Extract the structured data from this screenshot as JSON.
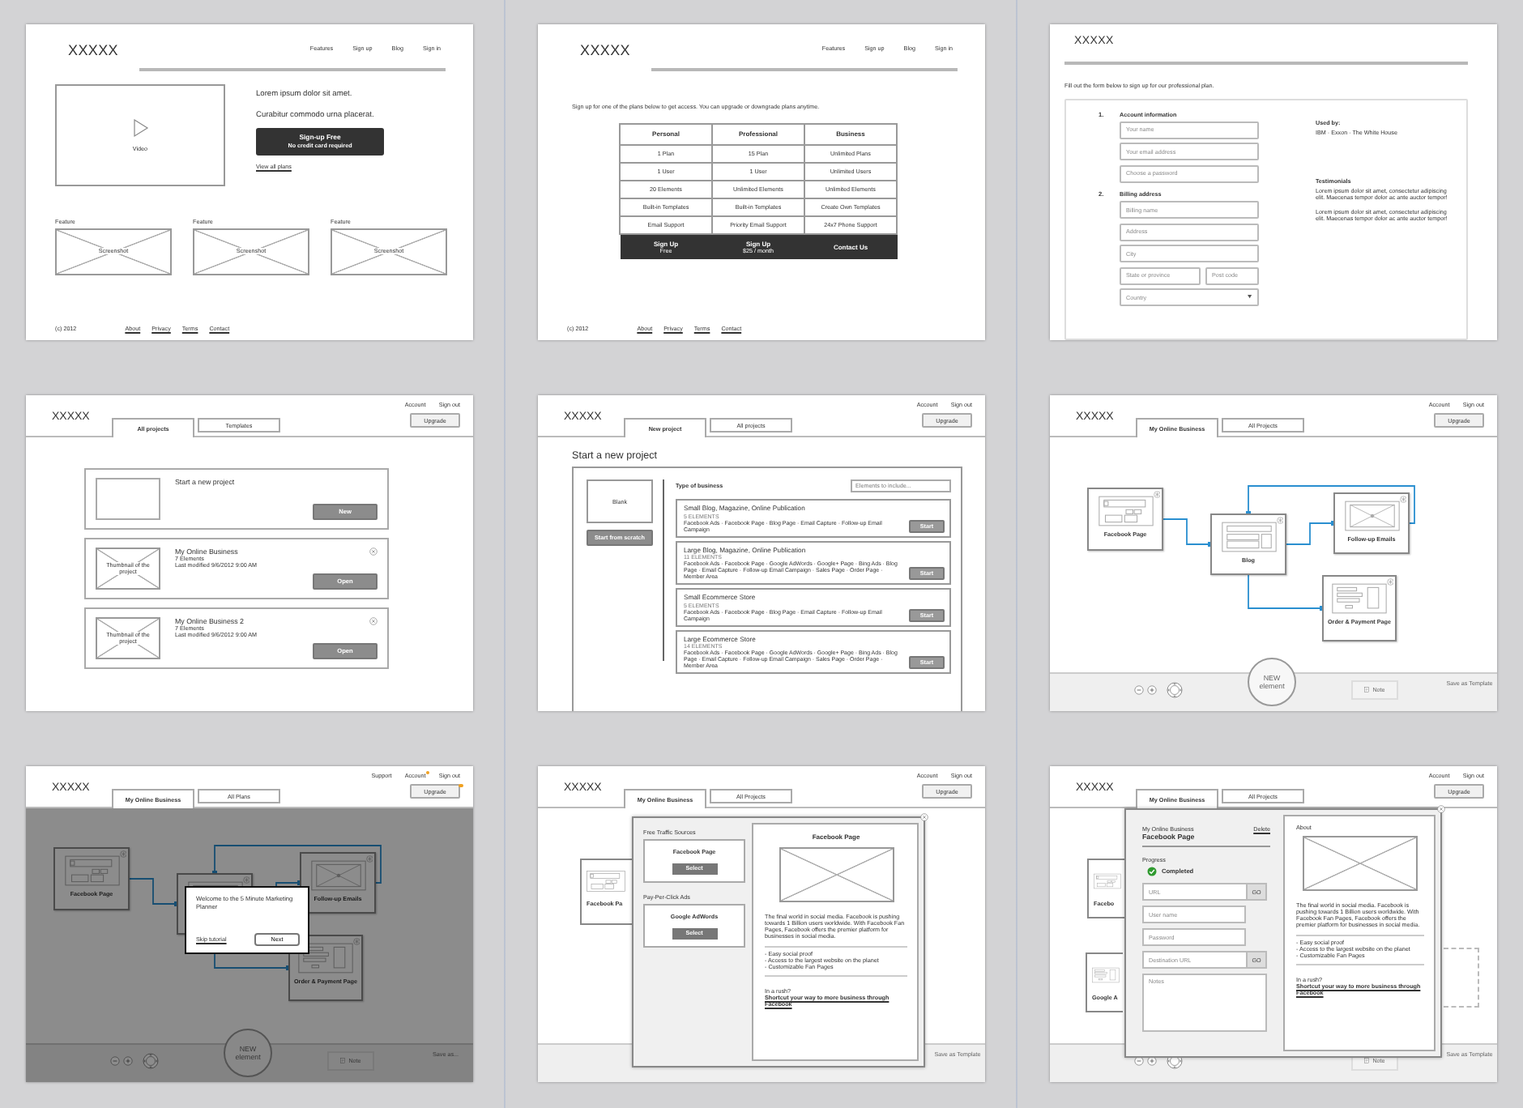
{
  "panels": [
    {
      "kind": "landing",
      "logo": "XXXXX",
      "nav": [
        "Features",
        "Sign up",
        "Blog",
        "Sign in"
      ],
      "video_label": "Video",
      "headline": "Lorem ipsum dolor sit amet.",
      "subhead": "Curabitur commodo urna placerat.",
      "cta": {
        "label": "Sign-up Free",
        "note": "No credit card required"
      },
      "plans_link": "View all plans",
      "features": [
        {
          "title": "Feature",
          "image_label": "Screenshot"
        },
        {
          "title": "Feature",
          "image_label": "Screenshot"
        },
        {
          "title": "Feature",
          "image_label": "Screenshot"
        }
      ],
      "copyright": "(c) 2012",
      "footer_links": [
        "About",
        "Privacy",
        "Terms",
        "Contact"
      ]
    },
    {
      "kind": "pricing",
      "logo": "XXXXX",
      "nav": [
        "Features",
        "Sign up",
        "Blog",
        "Sign in"
      ],
      "intro": "Sign up for one of the plans below to get access.  You can upgrade or downgrade plans anytime.",
      "table": {
        "columns": [
          "Personal",
          "Professional",
          "Business"
        ],
        "rows": [
          [
            "1 Plan",
            "15 Plan",
            "Unlimited Plans"
          ],
          [
            "1 User",
            "1 User",
            "Unlimited Users"
          ],
          [
            "20 Elements",
            "Unlimited Elements",
            "Unlimited Elements"
          ],
          [
            "Built-in Templates",
            "Built-in Templates",
            "Create Own Templates"
          ],
          [
            "Email Support",
            "Priority Email Support",
            "24x7 Phone Support"
          ]
        ],
        "actions": [
          {
            "label": "Sign Up",
            "note": "Free"
          },
          {
            "label": "Sign Up",
            "note": "$25 / month"
          },
          {
            "label": "Contact Us"
          }
        ]
      },
      "copyright": "(c) 2012",
      "footer_links": [
        "About",
        "Privacy",
        "Terms",
        "Contact"
      ]
    },
    {
      "kind": "signup",
      "logo": "XXXXX",
      "intro": "Fill out the form below to sign up for our professional plan.",
      "sections": [
        {
          "number": "1.",
          "title": "Account information",
          "rows": [
            [
              {
                "kind": "text",
                "placeholder": "Your name"
              }
            ],
            [
              {
                "kind": "text",
                "placeholder": "Your email address"
              }
            ],
            [
              {
                "kind": "text",
                "placeholder": "Choose a password"
              }
            ]
          ]
        },
        {
          "number": "2.",
          "title": "Billing address",
          "rows": [
            [
              {
                "kind": "text",
                "placeholder": "Billing name"
              }
            ],
            [
              {
                "kind": "text",
                "placeholder": "Address"
              }
            ],
            [
              {
                "kind": "text",
                "placeholder": "City"
              }
            ],
            [
              {
                "kind": "text",
                "placeholder": "State or province"
              },
              {
                "kind": "text",
                "placeholder": "Post code"
              }
            ],
            [
              {
                "kind": "select",
                "placeholder": "Country"
              }
            ]
          ]
        }
      ],
      "used_by": {
        "title": "Used by:",
        "text": "IBM · Exxon · The White House"
      },
      "testimonials": {
        "title": "Testimonials",
        "quotes": [
          "Lorem ipsum dolor sit amet, consectetur adipiscing elit. Maecenas tempor dolor ac ante auctor tempor!",
          "Lorem ipsum dolor sit amet, consectetur adipiscing elit. Maecenas tempor dolor ac ante auctor tempor!"
        ]
      }
    },
    {
      "kind": "projects",
      "header": {
        "logo": "XXXXX",
        "links": [
          {
            "label": "Account"
          },
          {
            "label": "Sign out"
          }
        ],
        "tabs": [
          {
            "label": "All projects",
            "selected": true
          },
          {
            "label": "Templates",
            "selected": false
          }
        ],
        "upgrade": {
          "label": "Upgrade"
        }
      },
      "new_card": {
        "title": "Start a new project",
        "button": "New"
      },
      "projects": [
        {
          "name": "My Online Business",
          "elements": "7 Elements",
          "modified": "Last modified 9/6/2012 9:00 AM",
          "thumb_label": "Thumbnail of the project",
          "button": "Open"
        },
        {
          "name": "My Online Business 2",
          "elements": "7 Elements",
          "modified": "Last modified 9/6/2012 9:00 AM",
          "thumb_label": "Thumbnail of the project",
          "button": "Open"
        }
      ]
    },
    {
      "kind": "new_project",
      "header": {
        "logo": "XXXXX",
        "links": [
          {
            "label": "Account"
          },
          {
            "label": "Sign out"
          }
        ],
        "tabs": [
          {
            "label": "New project",
            "selected": true
          },
          {
            "label": "All projects",
            "selected": false
          }
        ],
        "upgrade": {
          "label": "Upgrade"
        }
      },
      "title": "Start a new project",
      "blank": {
        "label": "Blank",
        "button": "Start from scratch"
      },
      "filter_label": "Type of business",
      "search": {
        "placeholder": "Elements to include..."
      },
      "templates": [
        {
          "name": "Small Blog, Magazine, Online Publication",
          "count": "5 ELEMENTS",
          "elements": "Facebook Ads · Facebook Page · Blog Page · Email Capture · Follow-up Email Campaign",
          "button": "Start"
        },
        {
          "name": "Large Blog, Magazine, Online Publication",
          "count": "11 ELEMENTS",
          "elements": "Facebook Ads · Facebook Page · Google AdWords · Google+ Page · Bing Ads · Blog Page · Email Capture · Follow-up Email Campaign · Sales Page · Order Page · Member Area",
          "button": "Start"
        },
        {
          "name": "Small Ecommerce Store",
          "count": "5 ELEMENTS",
          "elements": "Facebook Ads · Facebook Page · Blog Page · Email Capture · Follow-up Email Campaign",
          "button": "Start"
        },
        {
          "name": "Large Ecommerce Store",
          "count": "14 ELEMENTS",
          "elements": "Facebook Ads · Facebook Page · Google AdWords · Google+ Page · Bing Ads · Blog Page · Email Capture · Follow-up Email Campaign · Sales Page · Order Page · Member Area",
          "button": "Start"
        }
      ]
    },
    {
      "kind": "canvas",
      "header": {
        "logo": "XXXXX",
        "links": [
          {
            "label": "Account"
          },
          {
            "label": "Sign out"
          }
        ],
        "tabs": [
          {
            "label": "My Online Business",
            "selected": true
          },
          {
            "label": "All Projects",
            "selected": false
          }
        ],
        "upgrade": {
          "label": "Upgrade"
        }
      },
      "canvas": {
        "nodes": [
          {
            "kind": "social",
            "label": "Facebook Page"
          },
          {
            "kind": "blog",
            "label": "Blog"
          },
          {
            "kind": "email",
            "label": "Follow-up Emails"
          },
          {
            "kind": "form",
            "label": "Order & Payment Page"
          }
        ]
      },
      "toolbar": [
        {
          "kind": "zoom_out"
        },
        {
          "kind": "zoom_in"
        },
        {
          "kind": "pan"
        },
        {
          "kind": "new",
          "label": "NEW",
          "sub": "element"
        },
        {
          "kind": "note",
          "label": "Note"
        },
        {
          "kind": "save",
          "label": "Save as Template"
        }
      ]
    },
    {
      "kind": "tutorial",
      "header": {
        "logo": "XXXXX",
        "links": [
          {
            "label": "Support",
            "badge": false
          },
          {
            "label": "Account",
            "badge": true
          },
          {
            "label": "Sign out",
            "badge": false
          }
        ],
        "tabs": [
          {
            "label": "My Online Business",
            "selected": true
          },
          {
            "label": "All Plans",
            "selected": false
          }
        ],
        "upgrade": {
          "label": "Upgrade",
          "badge": true
        }
      },
      "canvas": {
        "nodes": [
          {
            "kind": "social",
            "label": "Facebook Page"
          },
          {
            "kind": "blog"
          },
          {
            "kind": "email",
            "label": "Follow-up Emails"
          },
          {
            "kind": "form",
            "label": "Order & Payment Page"
          }
        ]
      },
      "toolbar": [
        {
          "kind": "zoom_out"
        },
        {
          "kind": "zoom_in"
        },
        {
          "kind": "pan"
        },
        {
          "kind": "new",
          "label": "NEW",
          "sub": "element"
        },
        {
          "kind": "note",
          "label": "Note"
        },
        {
          "kind": "save",
          "label": "Save as..."
        }
      ],
      "dimmed": true,
      "dialog": {
        "text": "Welcome to the 5 Minute Marketing Planner",
        "skip": "Skip tutorial",
        "next": "Next"
      }
    },
    {
      "kind": "traffic_sources",
      "header": {
        "logo": "XXXXX",
        "links": [
          {
            "label": "Account"
          },
          {
            "label": "Sign out"
          }
        ],
        "tabs": [
          {
            "label": "My Online Business",
            "selected": true
          },
          {
            "label": "All Projects",
            "selected": false
          }
        ],
        "upgrade": {
          "label": "Upgrade"
        }
      },
      "canvas": {
        "nodes": [
          {
            "kind": "social",
            "label": "Facebook Pa"
          }
        ]
      },
      "toolbar": [
        {
          "kind": "save",
          "label": "Save as Template"
        }
      ],
      "popover": {
        "groups": [
          {
            "title": "Free Traffic Sources",
            "items": [
              {
                "name": "Facebook Page",
                "button": "Select"
              }
            ]
          },
          {
            "title": "Pay-Per-Click Ads",
            "items": [
              {
                "name": "Google AdWords",
                "button": "Select"
              }
            ]
          }
        ],
        "detail": {
          "title": "Facebook Page",
          "description": "The final world in social media. Facebook is pushing towards 1 Billion users worldwide. With Facebook Fan Pages, Facebook offers the premier platform for businesses in social media.",
          "bullets": [
            "- Easy social proof",
            "- Access to the largest website on the planet",
            "- Customizable Fan Pages"
          ],
          "prompt": "In a rush?",
          "link": "Shortcut your way to more business through Facebook"
        }
      }
    },
    {
      "kind": "element_detail",
      "header": {
        "logo": "XXXXX",
        "links": [
          {
            "label": "Account"
          },
          {
            "label": "Sign out"
          }
        ],
        "tabs": [
          {
            "label": "My Online Business",
            "selected": true
          },
          {
            "label": "All Projects",
            "selected": false
          }
        ],
        "upgrade": {
          "label": "Upgrade"
        }
      },
      "canvas": {
        "nodes": [
          {
            "kind": "social",
            "label": "Facebo"
          },
          {
            "kind": "form",
            "label": "Google A"
          }
        ]
      },
      "toolbar": [
        {
          "kind": "zoom_out"
        },
        {
          "kind": "zoom_in"
        },
        {
          "kind": "pan"
        },
        {
          "kind": "note",
          "label": "Note"
        },
        {
          "kind": "save",
          "label": "Save as Template"
        }
      ],
      "popover": {
        "crumb": "My Online Business",
        "title": "Facebook Page",
        "delete": "Delete",
        "progress": {
          "label": "Progress",
          "status": "Completed",
          "completed": true
        },
        "fields": [
          {
            "kind": "go",
            "placeholder": "URL",
            "button": "GO"
          },
          {
            "kind": "text",
            "placeholder": "User name"
          },
          {
            "kind": "text",
            "placeholder": "Password"
          },
          {
            "kind": "go",
            "placeholder": "Destination URL",
            "button": "GO"
          },
          {
            "kind": "notes",
            "placeholder": "Notes"
          }
        ],
        "detail": {
          "label": "About",
          "description": "The final world in social media. Facebook is pushing towards 1 Billion users worldwide. With Facebook Fan Pages, Facebook offers the premier platform for businesses in social media.",
          "bullets": [
            "- Easy social proof",
            "- Access to the largest website on the planet",
            "- Customizable Fan Pages"
          ],
          "prompt": "In a rush?",
          "link": "Shortcut your way to more business through Facebook"
        }
      }
    }
  ]
}
